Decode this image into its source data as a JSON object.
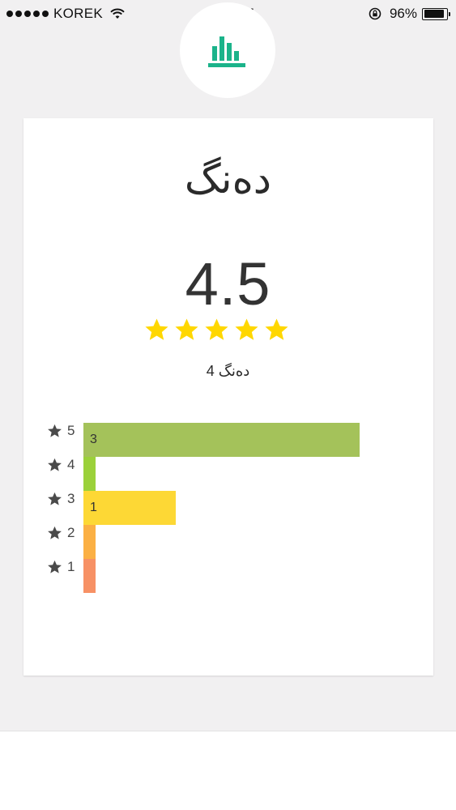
{
  "status_bar": {
    "carrier": "KOREK",
    "time": "6:19 PM",
    "battery_percent": "96%",
    "signal_bars": 5,
    "battery_level": 0.96
  },
  "app_icon": "bar-chart-icon",
  "card": {
    "title": "دەنگ",
    "average": "4.5",
    "stars_filled": 5,
    "count_label": "4 دەنگ"
  },
  "colors": {
    "accent": "#1bb38a",
    "star": "#ffd700",
    "bar_5": "#a4c25a",
    "bar_4": "#9bd13a",
    "bar_3": "#fdd835",
    "bar_2": "#fbb044",
    "bar_1": "#f79165"
  },
  "distribution": {
    "max_count": 3,
    "rows": [
      {
        "label": "5",
        "count": 3,
        "value_label": "3"
      },
      {
        "label": "4",
        "count": 0,
        "value_label": ""
      },
      {
        "label": "3",
        "count": 1,
        "value_label": "1"
      },
      {
        "label": "2",
        "count": 0,
        "value_label": ""
      },
      {
        "label": "1",
        "count": 0,
        "value_label": ""
      }
    ]
  }
}
